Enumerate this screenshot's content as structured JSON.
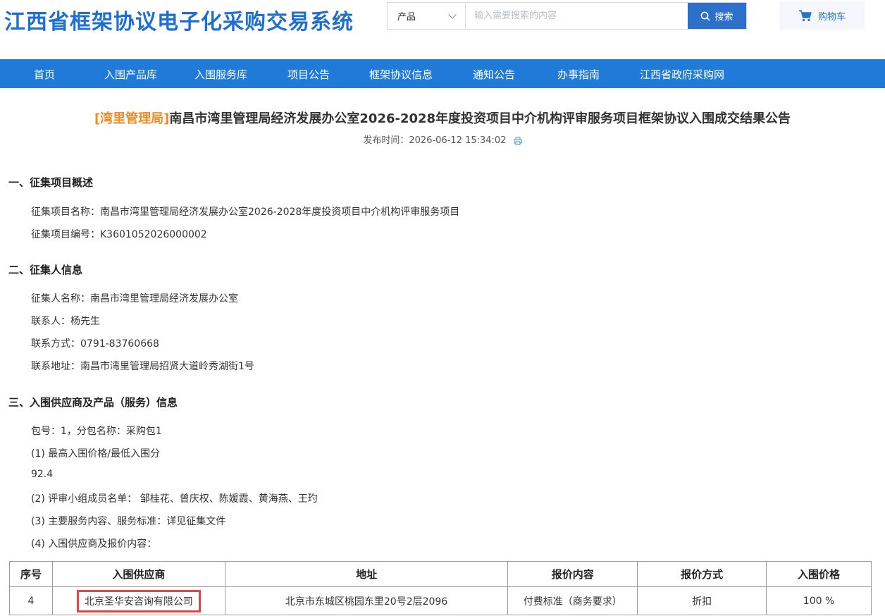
{
  "header": {
    "site_title": "江西省框架协议电子化采购交易系统",
    "search": {
      "type_selected": "产品",
      "placeholder": "输入需要搜索的内容",
      "button_label": "搜索"
    },
    "cart_label": "购物车"
  },
  "nav": {
    "items": [
      "首页",
      "入围产品库",
      "入围服务库",
      "项目公告",
      "框架协议信息",
      "通知公告",
      "办事指南",
      "江西省政府采购网"
    ]
  },
  "article": {
    "title_tag": "[湾里管理局]",
    "title": "南昌市湾里管理局经济发展办公室2026-2028年度投资项目中介机构评审服务项目框架协议入围成交结果公告",
    "pub_label": "发布时间：",
    "pub_time": "2026-06-12 15:34:02",
    "section1": {
      "heading": "一、征集项目概述",
      "lines": [
        "征集项目名称：南昌市湾里管理局经济发展办公室2026-2028年度投资项目中介机构评审服务项目",
        "征集项目编号：K3601052026000002"
      ]
    },
    "section2": {
      "heading": "二、征集人信息",
      "lines": [
        "征集人名称：南昌市湾里管理局经济发展办公室",
        "联系人：杨先生",
        "联系方式：0791-83760668",
        "联系地址：南昌市湾里管理局招贤大道岭秀湖街1号"
      ]
    },
    "section3": {
      "heading": "三、入围供应商及产品（服务）信息",
      "lines": [
        "包号：1，分包名称：采购包1",
        "(1) 最高入围价格/最低入围分",
        "92.4",
        "(2) 评审小组成员名单： 邹桂花、曾庆权、陈媛霞、黄海燕、王玓",
        "(3) 主要服务内容、服务标准：详见征集文件",
        "(4) 入围供应商及报价内容："
      ]
    },
    "table": {
      "headers": [
        "序号",
        "入围供应商",
        "地址",
        "报价内容",
        "报价方式",
        "入围价格"
      ],
      "rows": [
        [
          "4",
          "北京圣华安咨询有限公司",
          "北京市东城区桃园东里20号2层2096",
          "付费标准（商务要求）",
          "折扣",
          "100 %"
        ]
      ]
    }
  },
  "colors": {
    "brand_blue": "#1e6fcf",
    "nav_blue": "#1f7ad8",
    "tag_orange": "#f08b22",
    "highlight_red": "#e64545"
  },
  "icons": [
    "chevron-down-icon",
    "search-icon",
    "cart-icon",
    "print-icon"
  ]
}
